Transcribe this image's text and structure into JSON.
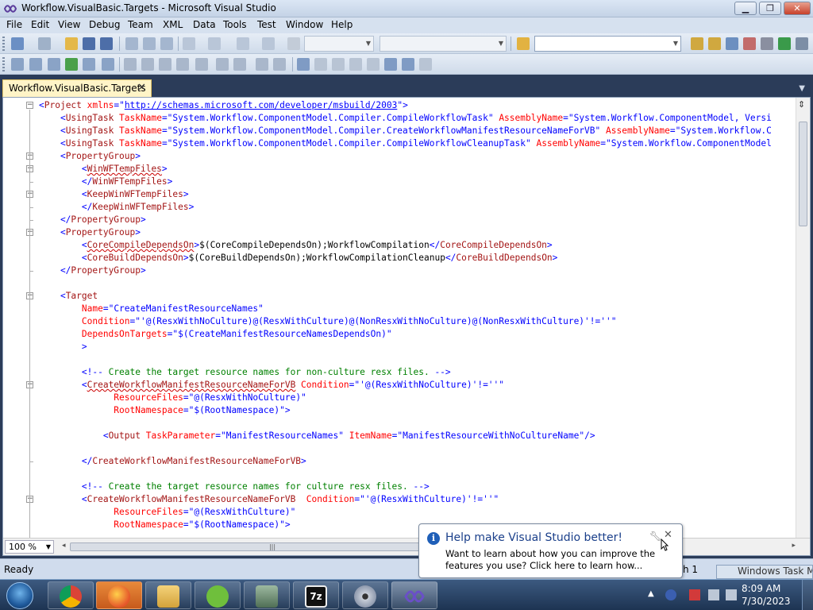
{
  "window": {
    "title": "Workflow.VisualBasic.Targets - Microsoft Visual Studio",
    "minimize": "▁",
    "maximize": "❐",
    "close": "✕"
  },
  "menu": [
    "File",
    "Edit",
    "View",
    "Debug",
    "Team",
    "XML",
    "Data",
    "Tools",
    "Test",
    "Window",
    "Help"
  ],
  "document": {
    "tab_label": "Workflow.VisualBasic.Targets",
    "tab_close": "✕",
    "zoom": "100 %"
  },
  "code_lines": [
    [
      [
        "b",
        "<"
      ],
      [
        "e",
        "Project"
      ],
      [
        "a",
        " xmlns"
      ],
      [
        "b",
        "=\""
      ],
      [
        "u",
        "http://schemas.microsoft.com/developer/msbuild/2003"
      ],
      [
        "b",
        "\">"
      ]
    ],
    [
      [
        "b",
        "    <"
      ],
      [
        "e",
        "UsingTask"
      ],
      [
        "a",
        " TaskName"
      ],
      [
        "b",
        "=\""
      ],
      [
        "v",
        "System.Workflow.ComponentModel.Compiler.CompileWorkflowTask"
      ],
      [
        "b",
        "\""
      ],
      [
        "a",
        " AssemblyName"
      ],
      [
        "b",
        "=\""
      ],
      [
        "v",
        "System.Workflow.ComponentModel, Versi"
      ]
    ],
    [
      [
        "b",
        "    <"
      ],
      [
        "e",
        "UsingTask"
      ],
      [
        "a",
        " TaskName"
      ],
      [
        "b",
        "=\""
      ],
      [
        "v",
        "System.Workflow.ComponentModel.Compiler.CreateWorkflowManifestResourceNameForVB"
      ],
      [
        "b",
        "\""
      ],
      [
        "a",
        " AssemblyName"
      ],
      [
        "b",
        "=\""
      ],
      [
        "v",
        "System.Workflow.C"
      ]
    ],
    [
      [
        "b",
        "    <"
      ],
      [
        "e",
        "UsingTask"
      ],
      [
        "a",
        " TaskName"
      ],
      [
        "b",
        "=\""
      ],
      [
        "v",
        "System.Workflow.ComponentModel.Compiler.CompileWorkflowCleanupTask"
      ],
      [
        "b",
        "\""
      ],
      [
        "a",
        " AssemblyName"
      ],
      [
        "b",
        "=\""
      ],
      [
        "v",
        "System.Workflow.ComponentModel"
      ]
    ],
    [
      [
        "b",
        "    <"
      ],
      [
        "e",
        "PropertyGroup"
      ],
      [
        "b",
        ">"
      ]
    ],
    [
      [
        "b",
        "        <"
      ],
      [
        "e sq",
        "WinWFTempFiles"
      ],
      [
        "b",
        ">"
      ]
    ],
    [
      [
        "b",
        "        </"
      ],
      [
        "e",
        "WinWFTempFiles"
      ],
      [
        "b",
        ">"
      ]
    ],
    [
      [
        "b",
        "        <"
      ],
      [
        "e",
        "KeepWinWFTempFiles"
      ],
      [
        "b",
        ">"
      ]
    ],
    [
      [
        "b",
        "        </"
      ],
      [
        "e",
        "KeepWinWFTempFiles"
      ],
      [
        "b",
        ">"
      ]
    ],
    [
      [
        "b",
        "    </"
      ],
      [
        "e",
        "PropertyGroup"
      ],
      [
        "b",
        ">"
      ]
    ],
    [
      [
        "b",
        "    <"
      ],
      [
        "e",
        "PropertyGroup"
      ],
      [
        "b",
        ">"
      ]
    ],
    [
      [
        "b",
        "        <"
      ],
      [
        "e sq",
        "CoreCompileDependsOn"
      ],
      [
        "b",
        ">"
      ],
      [
        "t",
        "$(CoreCompileDependsOn);WorkflowCompilation"
      ],
      [
        "b",
        "</"
      ],
      [
        "e",
        "CoreCompileDependsOn"
      ],
      [
        "b",
        ">"
      ]
    ],
    [
      [
        "b",
        "        <"
      ],
      [
        "e",
        "CoreBuildDependsOn"
      ],
      [
        "b",
        ">"
      ],
      [
        "t",
        "$(CoreBuildDependsOn);WorkflowCompilationCleanup"
      ],
      [
        "b",
        "</"
      ],
      [
        "e",
        "CoreBuildDependsOn"
      ],
      [
        "b",
        ">"
      ]
    ],
    [
      [
        "b",
        "    </"
      ],
      [
        "e",
        "PropertyGroup"
      ],
      [
        "b",
        ">"
      ]
    ],
    [],
    [
      [
        "b",
        "    <"
      ],
      [
        "e",
        "Target"
      ]
    ],
    [
      [
        "a",
        "        Name"
      ],
      [
        "b",
        "=\""
      ],
      [
        "v",
        "CreateManifestResourceNames"
      ],
      [
        "b",
        "\""
      ]
    ],
    [
      [
        "a",
        "        Condition"
      ],
      [
        "b",
        "=\""
      ],
      [
        "v",
        "'@(ResxWithNoCulture)@(ResxWithCulture)@(NonResxWithNoCulture)@(NonResxWithCulture)'!=''"
      ],
      [
        "b",
        "\""
      ]
    ],
    [
      [
        "a",
        "        DependsOnTargets"
      ],
      [
        "b",
        "=\""
      ],
      [
        "v",
        "$(CreateManifestResourceNamesDependsOn)"
      ],
      [
        "b",
        "\""
      ]
    ],
    [
      [
        "b",
        "        >"
      ]
    ],
    [],
    [
      [
        "b",
        "        <!--"
      ],
      [
        "c",
        " Create the target resource names for non-culture resx files. "
      ],
      [
        "b",
        "-->"
      ]
    ],
    [
      [
        "b",
        "        <"
      ],
      [
        "e sq",
        "CreateWorkflowManifestResourceNameForVB"
      ],
      [
        "a",
        " Condition"
      ],
      [
        "b",
        "=\""
      ],
      [
        "v",
        "'@(ResxWithNoCulture)'!=''"
      ],
      [
        "b",
        "\""
      ]
    ],
    [
      [
        "a",
        "              ResourceFiles"
      ],
      [
        "b",
        "=\""
      ],
      [
        "v",
        "@(ResxWithNoCulture)"
      ],
      [
        "b",
        "\""
      ]
    ],
    [
      [
        "a",
        "              RootNamespace"
      ],
      [
        "b",
        "=\""
      ],
      [
        "v",
        "$(RootNamespace)"
      ],
      [
        "b",
        "\">"
      ]
    ],
    [],
    [
      [
        "b",
        "            <"
      ],
      [
        "e",
        "Output"
      ],
      [
        "a",
        " TaskParameter"
      ],
      [
        "b",
        "=\""
      ],
      [
        "v",
        "ManifestResourceNames"
      ],
      [
        "b",
        "\""
      ],
      [
        "a",
        " ItemName"
      ],
      [
        "b",
        "=\""
      ],
      [
        "v",
        "ManifestResourceWithNoCultureName"
      ],
      [
        "b",
        "\"/>"
      ]
    ],
    [],
    [
      [
        "b",
        "        </"
      ],
      [
        "e",
        "CreateWorkflowManifestResourceNameForVB"
      ],
      [
        "b",
        ">"
      ]
    ],
    [],
    [
      [
        "b",
        "        <!--"
      ],
      [
        "c",
        " Create the target resource names for culture resx files. "
      ],
      [
        "b",
        "-->"
      ]
    ],
    [
      [
        "b",
        "        <"
      ],
      [
        "e",
        "CreateWorkflowManifestResourceNameForVB"
      ],
      [
        "a",
        "  Condition"
      ],
      [
        "b",
        "=\""
      ],
      [
        "v",
        "'@(ResxWithCulture)'!=''"
      ],
      [
        "b",
        "\""
      ]
    ],
    [
      [
        "a",
        "              ResourceFiles"
      ],
      [
        "b",
        "=\""
      ],
      [
        "v",
        "@(ResxWithCulture)"
      ],
      [
        "b",
        "\""
      ]
    ],
    [
      [
        "a",
        "              RootNamespace"
      ],
      [
        "b",
        "=\""
      ],
      [
        "v",
        "$(RootNamespace)"
      ],
      [
        "b",
        "\">"
      ]
    ]
  ],
  "status": {
    "text": "Ready",
    "extra": "h 1"
  },
  "notification": {
    "title": "Help make Visual Studio better!",
    "body": "Want to learn about how you can improve the features you use? Click here to learn how...",
    "close": "✕"
  },
  "taskbar": {
    "window_button": "Windows Task Ma",
    "clock_time": "8:09 AM",
    "clock_date": "7/30/2023"
  },
  "colors": {
    "xml_bracket": "#0000ff",
    "xml_element": "#a31515",
    "xml_attribute": "#ff0000",
    "xml_value": "#0000ff",
    "xml_comment": "#008000",
    "tab_active": "#fff4c7"
  }
}
